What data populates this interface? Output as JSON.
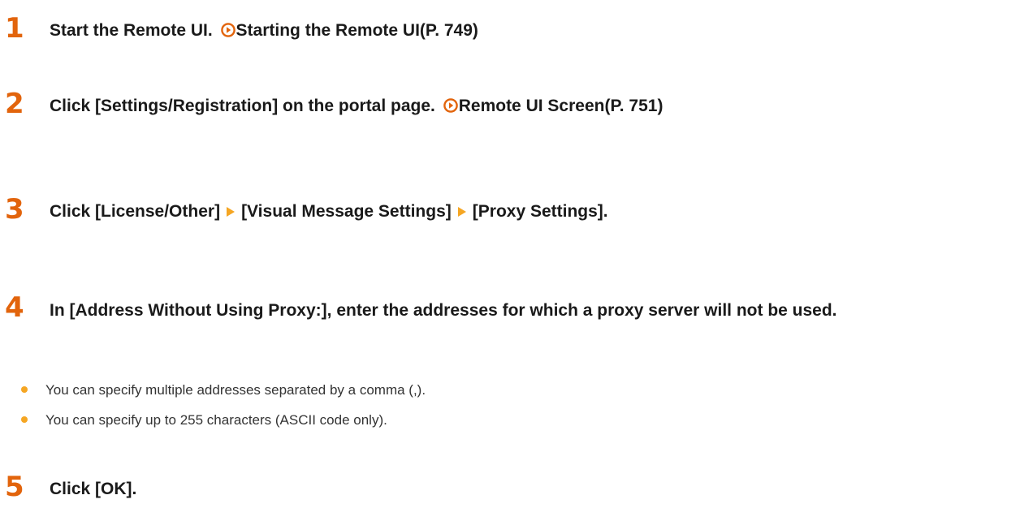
{
  "steps": [
    {
      "number": "1",
      "text": "Start the Remote UI. ",
      "link": "Starting the Remote UI(P. 749)"
    },
    {
      "number": "2",
      "text": "Click [Settings/Registration] on the portal page. ",
      "link": "Remote UI Screen(P. 751)"
    },
    {
      "number": "3",
      "parts": [
        "Click [License/Other]",
        "[Visual Message Settings]",
        "[Proxy Settings]."
      ]
    },
    {
      "number": "4",
      "text": "In [Address Without Using Proxy:], enter the addresses for which a proxy server will not be used.",
      "bullets": [
        "You can specify multiple addresses separated by a comma (,).",
        "You can specify up to 255 characters (ASCII code only)."
      ]
    },
    {
      "number": "5",
      "text": "Click [OK]."
    }
  ],
  "colors": {
    "accent": "#e2640c",
    "bullet": "#f5a623",
    "link_icon": "#e2640c"
  },
  "icons": {
    "link": "circle-arrow-icon",
    "step_arrow": "triangle-right-icon"
  }
}
